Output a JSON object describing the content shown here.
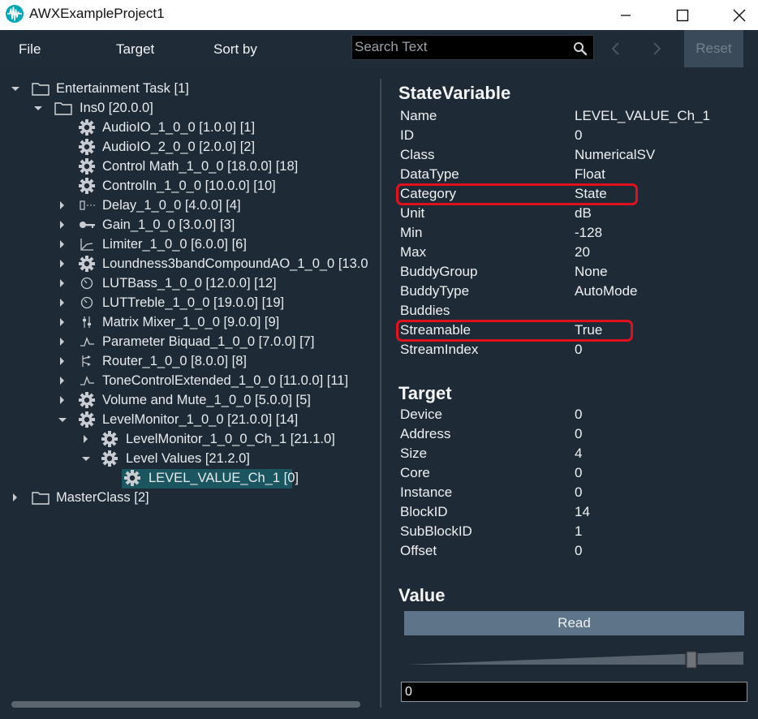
{
  "window": {
    "title": "AWXExampleProject1"
  },
  "menu": {
    "file": "File",
    "target": "Target",
    "sort_by": "Sort by"
  },
  "search": {
    "placeholder": "Search Text",
    "value": ""
  },
  "toolbar": {
    "reset_label": "Reset"
  },
  "tree": {
    "nodes": [
      {
        "label": "Entertainment Task [1]",
        "icon": "folder-icon",
        "expander": "open"
      },
      {
        "label": "Ins0 [20.0.0]",
        "icon": "folder-icon",
        "expander": "open"
      },
      {
        "label": "AudioIO_1_0_0 [1.0.0] [1]",
        "icon": "gear-icon",
        "expander": "none"
      },
      {
        "label": "AudioIO_2_0_0 [2.0.0] [2]",
        "icon": "gear-icon",
        "expander": "none"
      },
      {
        "label": "Control Math_1_0_0 [18.0.0] [18]",
        "icon": "gear-icon",
        "expander": "none"
      },
      {
        "label": "ControlIn_1_0_0 [10.0.0] [10]",
        "icon": "gear-icon",
        "expander": "none"
      },
      {
        "label": "Delay_1_0_0 [4.0.0] [4]",
        "icon": "delay-icon",
        "expander": "closed"
      },
      {
        "label": "Gain_1_0_0 [3.0.0] [3]",
        "icon": "key-icon",
        "expander": "closed"
      },
      {
        "label": "Limiter_1_0_0 [6.0.0] [6]",
        "icon": "limiter-icon",
        "expander": "closed"
      },
      {
        "label": "Loundness3bandCompoundAO_1_0_0 [13.0",
        "icon": "gear-icon",
        "expander": "closed"
      },
      {
        "label": "LUTBass_1_0_0 [12.0.0] [12]",
        "icon": "dial-icon",
        "expander": "closed"
      },
      {
        "label": "LUTTreble_1_0_0 [19.0.0] [19]",
        "icon": "dial-icon",
        "expander": "closed"
      },
      {
        "label": "Matrix Mixer_1_0_0 [9.0.0] [9]",
        "icon": "mixer-icon",
        "expander": "closed"
      },
      {
        "label": "Parameter Biquad_1_0_0 [7.0.0] [7]",
        "icon": "biquad-icon",
        "expander": "closed"
      },
      {
        "label": "Router_1_0_0 [8.0.0] [8]",
        "icon": "router-icon",
        "expander": "closed"
      },
      {
        "label": "ToneControlExtended_1_0_0 [11.0.0] [11]",
        "icon": "biquad-icon",
        "expander": "closed"
      },
      {
        "label": "Volume and Mute_1_0_0 [5.0.0] [5]",
        "icon": "gear-icon",
        "expander": "closed"
      },
      {
        "label": "LevelMonitor_1_0_0 [21.0.0] [14]",
        "icon": "gear-icon",
        "expander": "open"
      },
      {
        "label": "LevelMonitor_1_0_0_Ch_1 [21.1.0]",
        "icon": "gear-icon",
        "expander": "closed"
      },
      {
        "label": "Level Values [21.2.0]",
        "icon": "gear-icon",
        "expander": "open"
      },
      {
        "label": "LEVEL_VALUE_Ch_1 [0]",
        "icon": "gear-icon",
        "expander": "none",
        "selected": true
      },
      {
        "label": "MasterClass [2]",
        "icon": "folder-icon",
        "expander": "closed"
      }
    ]
  },
  "state_variable": {
    "title": "StateVariable",
    "rows": [
      {
        "name": "Name",
        "value": "LEVEL_VALUE_Ch_1"
      },
      {
        "name": "ID",
        "value": "0"
      },
      {
        "name": "Class",
        "value": "NumericalSV"
      },
      {
        "name": "DataType",
        "value": "Float"
      },
      {
        "name": "Category",
        "value": "State",
        "highlighted": true
      },
      {
        "name": "Unit",
        "value": "dB"
      },
      {
        "name": "Min",
        "value": "-128"
      },
      {
        "name": "Max",
        "value": "20"
      },
      {
        "name": "BuddyGroup",
        "value": "None"
      },
      {
        "name": "BuddyType",
        "value": "AutoMode"
      },
      {
        "name": "Buddies",
        "value": ""
      },
      {
        "name": "Streamable",
        "value": "True",
        "highlighted": true
      },
      {
        "name": "StreamIndex",
        "value": "0"
      }
    ]
  },
  "target": {
    "title": "Target",
    "rows": [
      {
        "name": "Device",
        "value": "0"
      },
      {
        "name": "Address",
        "value": "0"
      },
      {
        "name": "Size",
        "value": "4"
      },
      {
        "name": "Core",
        "value": "0"
      },
      {
        "name": "Instance",
        "value": "0"
      },
      {
        "name": "BlockID",
        "value": "14"
      },
      {
        "name": "SubBlockID",
        "value": "1"
      },
      {
        "name": "Offset",
        "value": "0"
      }
    ]
  },
  "value_section": {
    "title": "Value",
    "read_label": "Read",
    "input_value": "0",
    "slider_level": 0.86
  },
  "colors": {
    "highlight": "#e0121e",
    "selection": "#1a5560",
    "read_button": "#5d7489"
  }
}
